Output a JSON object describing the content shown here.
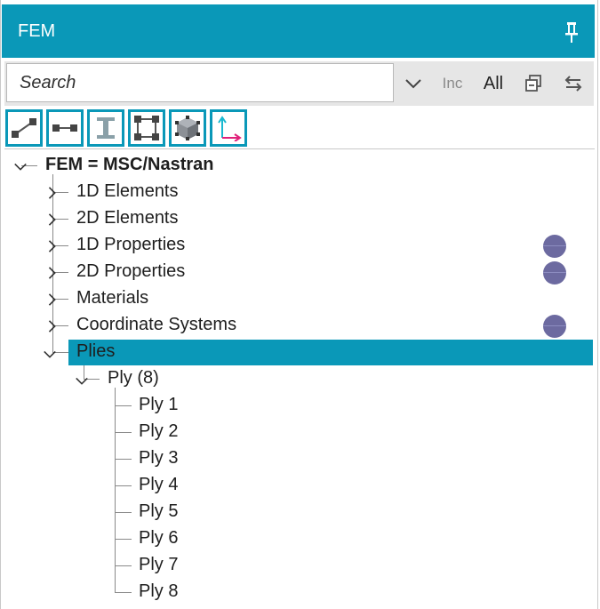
{
  "panel": {
    "title": "FEM",
    "pin_icon": "pin-icon",
    "accent_color": "#0a98b8",
    "selected_color": "#0a98b8",
    "status_dot_color": "#6c6aa0"
  },
  "search": {
    "placeholder": "Search",
    "dropdown_icon": "chevron-down-icon",
    "inc_label": "Inc",
    "all_label": "All",
    "collapse_icon": "collapse-all-icon",
    "sync_icon": "sync-arrows-icon"
  },
  "toolbar": {
    "tools": [
      {
        "icon": "line-element-icon"
      },
      {
        "icon": "bar-element-icon"
      },
      {
        "icon": "beam-section-icon"
      },
      {
        "icon": "shell-element-icon"
      },
      {
        "icon": "solid-element-icon"
      },
      {
        "icon": "coordinate-system-icon"
      }
    ]
  },
  "tree": {
    "root": {
      "label": "FEM = MSC/Nastran",
      "expanded": true
    },
    "items": [
      {
        "label": "1D Elements",
        "expanded": false,
        "status_dot": false
      },
      {
        "label": "2D Elements",
        "expanded": false,
        "status_dot": false
      },
      {
        "label": "1D Properties",
        "expanded": false,
        "status_dot": true
      },
      {
        "label": "2D Properties",
        "expanded": false,
        "status_dot": true
      },
      {
        "label": "Materials",
        "expanded": false,
        "status_dot": false
      },
      {
        "label": "Coordinate Systems",
        "expanded": false,
        "status_dot": true
      },
      {
        "label": "Plies",
        "expanded": true,
        "selected": true,
        "status_dot": false
      }
    ],
    "ply_group": {
      "label": "Ply (8)",
      "expanded": true
    },
    "plies": [
      "Ply 1",
      "Ply 2",
      "Ply 3",
      "Ply 4",
      "Ply 5",
      "Ply 6",
      "Ply 7",
      "Ply 8"
    ]
  }
}
